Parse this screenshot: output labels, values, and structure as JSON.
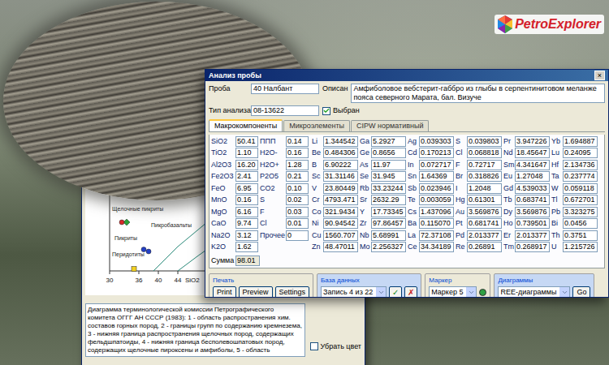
{
  "logo": {
    "text": "PetroExplorer"
  },
  "diagram_window": {
    "close": "×",
    "chart": {
      "x_ticks": [
        "30",
        "36",
        "40",
        "44"
      ],
      "x_label": "SiO2",
      "boundaries": [
        [
          [
            39,
            0
          ],
          [
            44,
            2.5
          ],
          [
            50,
            5
          ],
          [
            58,
            9
          ]
        ],
        [
          [
            44,
            0
          ],
          [
            48,
            1.5
          ],
          [
            55,
            4
          ]
        ]
      ],
      "fields": [
        {
          "label": "Щелочные пикриты",
          "x": 30.5,
          "y": 6.2
        },
        {
          "label": "Пикробазальты",
          "x": 38.5,
          "y": 4.5
        },
        {
          "label": "Пикриты",
          "x": 31,
          "y": 3.2
        },
        {
          "label": "Перидотиты",
          "x": 30.5,
          "y": 1.5
        }
      ],
      "points": [
        {
          "x": 33.5,
          "y": 5.0,
          "kind": "diamond",
          "color": "#2fa33a"
        },
        {
          "x": 32.5,
          "y": 5.0,
          "kind": "circle",
          "color": "#d92b2b"
        },
        {
          "x": 37,
          "y": 2.2,
          "kind": "circle",
          "color": "#2440c8"
        },
        {
          "x": 38,
          "y": 2.0,
          "kind": "circle",
          "color": "#2440c8"
        },
        {
          "x": 35,
          "y": 0.2,
          "kind": "square",
          "color": "#f2d021"
        }
      ]
    },
    "description": "Диаграмма терминологической комиссии Петрографического комитета ОГГГ АН СССР (1983): 1 - область распространения хим. составов горных пород, 2 - границы групп по содержанию кремнезема, 3 - нижняя граница распространения щелочных пород, содержащих фельдшпатоиды, 4 - нижняя граница бесполевошпатовых пород, содержащих щелочные пироксены и амфиболы, 5 - область",
    "checkbox": {
      "label": "Убрать цвет",
      "checked": false
    }
  },
  "analysis_window": {
    "title": "Анализ пробы",
    "close": "×",
    "sample_label": "Проба",
    "sample": "40 Налбант",
    "description_label": "Описан",
    "description": "Амфиболовое вебстерит-габбро из глыбы в серпентинитовом меланже пояса северного Марата, бал. Визуче",
    "analysis_type_label": "Тип анализа",
    "analysis_type": "08-13622",
    "selected_checkbox": {
      "label": "Выбран",
      "checked": true
    },
    "tabs": [
      {
        "label": "Макрокомпоненты",
        "selected": true
      },
      {
        "label": "Микроэлементы",
        "selected": false
      },
      {
        "label": "CIPW нормативный",
        "selected": false
      }
    ],
    "oxides": [
      {
        "name": "SiO2",
        "value": "50.41"
      },
      {
        "name": "TiO2",
        "value": "1.10"
      },
      {
        "name": "Al2O3",
        "value": "16.20"
      },
      {
        "name": "Fe2O3",
        "value": "2.41"
      },
      {
        "name": "FeO",
        "value": "6.95"
      },
      {
        "name": "MnO",
        "value": "0.16"
      },
      {
        "name": "MgO",
        "value": "6.16"
      },
      {
        "name": "CaO",
        "value": "9.74"
      },
      {
        "name": "Na2O",
        "value": "3.12"
      },
      {
        "name": "K2O",
        "value": "1.62"
      }
    ],
    "volatiles": [
      {
        "name": "ППП",
        "value": "0.14"
      },
      {
        "name": "H2O-",
        "value": "0.16"
      },
      {
        "name": "H2O+",
        "value": "1.28"
      },
      {
        "name": "P2O5",
        "value": "0.21"
      },
      {
        "name": "CO2",
        "value": "0.10"
      },
      {
        "name": "S",
        "value": "0.02"
      },
      {
        "name": "F",
        "value": "0.03"
      },
      {
        "name": "Cl",
        "value": "0.01"
      },
      {
        "name": "Прочее",
        "value": "0"
      }
    ],
    "total": {
      "label": "Сумма",
      "value": "98.01"
    },
    "elements": [
      [
        {
          "name": "Li",
          "value": "1.344542"
        },
        {
          "name": "Be",
          "value": "0.484306"
        },
        {
          "name": "B",
          "value": "6.90222"
        },
        {
          "name": "Sc",
          "value": "31.31146"
        },
        {
          "name": "V",
          "value": "23.80449"
        },
        {
          "name": "Cr",
          "value": "4793.471"
        },
        {
          "name": "Co",
          "value": "321.9434"
        },
        {
          "name": "Ni",
          "value": "90.94542"
        },
        {
          "name": "Cu",
          "value": "1560.707"
        },
        {
          "name": "Zn",
          "value": "48.47011"
        }
      ],
      [
        {
          "name": "Ga",
          "value": "5.2927"
        },
        {
          "name": "Ge",
          "value": "0.8656"
        },
        {
          "name": "As",
          "value": "11.97"
        },
        {
          "name": "Se",
          "value": "31.945"
        },
        {
          "name": "Rb",
          "value": "33.23244"
        },
        {
          "name": "Sr",
          "value": "2632.29"
        },
        {
          "name": "Y",
          "value": "17.73345"
        },
        {
          "name": "Zr",
          "value": "97.86457"
        },
        {
          "name": "Nb",
          "value": "5.68991"
        },
        {
          "name": "Mo",
          "value": "2.256327"
        }
      ],
      [
        {
          "name": "Ag",
          "value": "0.039303"
        },
        {
          "name": "Cd",
          "value": "0.170213"
        },
        {
          "name": "In",
          "value": "0.072717"
        },
        {
          "name": "Sn",
          "value": "1.64369"
        },
        {
          "name": "Sb",
          "value": "0.023946"
        },
        {
          "name": "Te",
          "value": "0.003059"
        },
        {
          "name": "Cs",
          "value": "1.437096"
        },
        {
          "name": "Ba",
          "value": "0.115070"
        },
        {
          "name": "La",
          "value": "72.37108"
        },
        {
          "name": "Ce",
          "value": "34.34189"
        }
      ],
      [
        {
          "name": "S",
          "value": "0.039803"
        },
        {
          "name": "Cl",
          "value": "0.068818"
        },
        {
          "name": "F",
          "value": "0.72717"
        },
        {
          "name": "Br",
          "value": "0.318826"
        },
        {
          "name": "I",
          "value": "1.2048"
        },
        {
          "name": "Hg",
          "value": "0.61301"
        },
        {
          "name": "Au",
          "value": "3.569876"
        },
        {
          "name": "Pt",
          "value": "0.681741"
        },
        {
          "name": "Pd",
          "value": "2.013377"
        },
        {
          "name": "Re",
          "value": "0.26891"
        }
      ],
      [
        {
          "name": "Pr",
          "value": "3.947226"
        },
        {
          "name": "Nd",
          "value": "18.45647"
        },
        {
          "name": "Sm",
          "value": "4.341647"
        },
        {
          "name": "Eu",
          "value": "1.27048"
        },
        {
          "name": "Gd",
          "value": "4.539033"
        },
        {
          "name": "Tb",
          "value": "0.683741"
        },
        {
          "name": "Dy",
          "value": "3.569876"
        },
        {
          "name": "Ho",
          "value": "0.739501"
        },
        {
          "name": "Er",
          "value": "2.013377"
        },
        {
          "name": "Tm",
          "value": "0.268917"
        }
      ],
      [
        {
          "name": "Yb",
          "value": "1.694887"
        },
        {
          "name": "Lu",
          "value": "0.24095"
        },
        {
          "name": "Hf",
          "value": "2.134736"
        },
        {
          "name": "Ta",
          "value": "0.237774"
        },
        {
          "name": "W",
          "value": "0.059118"
        },
        {
          "name": "Tl",
          "value": "0.672701"
        },
        {
          "name": "Pb",
          "value": "3.323275"
        },
        {
          "name": "Bi",
          "value": "0.0456"
        },
        {
          "name": "Th",
          "value": "0.3751"
        },
        {
          "name": "U",
          "value": "1.215726"
        }
      ]
    ],
    "toolbar": {
      "print": {
        "label": "Печать",
        "buttons": [
          "Print",
          "Preview",
          "Settings"
        ]
      },
      "database": {
        "label": "База данных",
        "record": "Запись 4 из 22",
        "ok": "✓",
        "cancel": "✗"
      },
      "marker": {
        "label": "Маркер",
        "value": "Маркер 5",
        "color": "#2ea043"
      },
      "diagrams": {
        "label": "Диаграммы",
        "value": "REE-диаграммы",
        "go": "Go"
      }
    }
  }
}
